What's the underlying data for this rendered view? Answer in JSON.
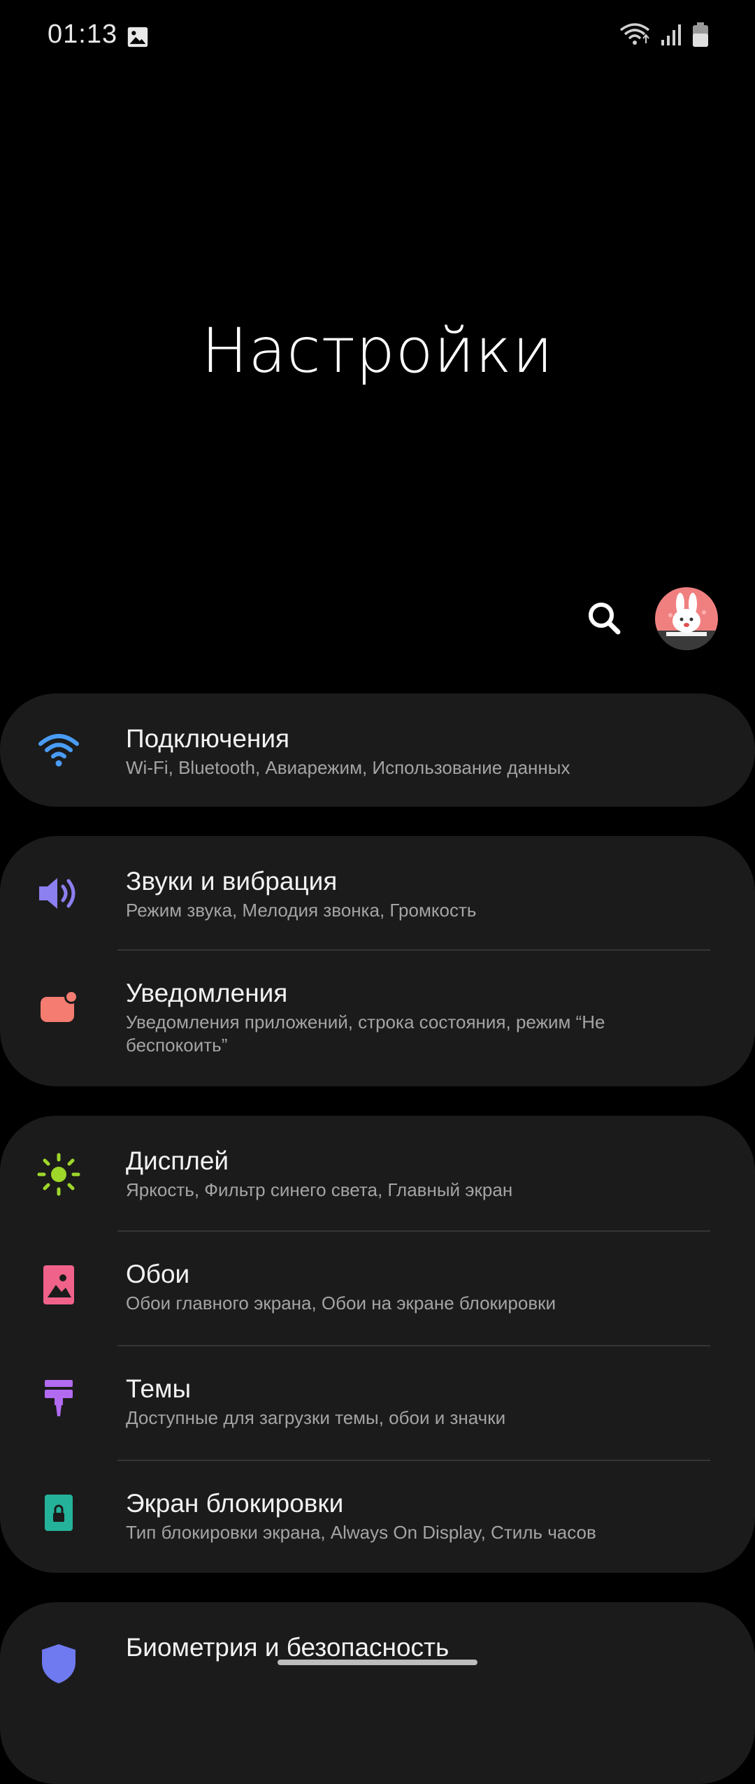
{
  "status_bar": {
    "time": "01:13",
    "icons": [
      "image-icon",
      "wifi-icon",
      "signal-icon",
      "battery-icon"
    ]
  },
  "header": {
    "title": "Настройки",
    "search_icon": "search-icon",
    "avatar": "profile-avatar"
  },
  "items": [
    {
      "title": "Подключения",
      "subtitle": "Wi-Fi, Bluetooth, Авиарежим, Использование данных",
      "icon": "wifi-icon",
      "color": "#4a9cf5"
    },
    {
      "title": "Звуки и вибрация",
      "subtitle": "Режим звука, Мелодия звонка, Громкость",
      "icon": "speaker-icon",
      "color": "#8c7ff0"
    },
    {
      "title": "Уведомления",
      "subtitle": "Уведомления приложений, строка состояния, режим “Не беспокоить”",
      "icon": "notification-icon",
      "color": "#f47c70"
    },
    {
      "title": "Дисплей",
      "subtitle": "Яркость, Фильтр синего света, Главный экран",
      "icon": "sun-icon",
      "color": "#9ed62a"
    },
    {
      "title": "Обои",
      "subtitle": "Обои главного экрана, Обои на экране блокировки",
      "icon": "wallpaper-icon",
      "color": "#f0628a"
    },
    {
      "title": "Темы",
      "subtitle": "Доступные для загрузки темы, обои и значки",
      "icon": "brush-icon",
      "color": "#b16af0"
    },
    {
      "title": "Экран блокировки",
      "subtitle": "Тип блокировки экрана, Always On Display, Стиль часов",
      "icon": "lock-icon",
      "color": "#24b39a"
    },
    {
      "title": "Биометрия и безопасность",
      "subtitle": "",
      "icon": "shield-icon",
      "color": "#6f79f0"
    }
  ]
}
